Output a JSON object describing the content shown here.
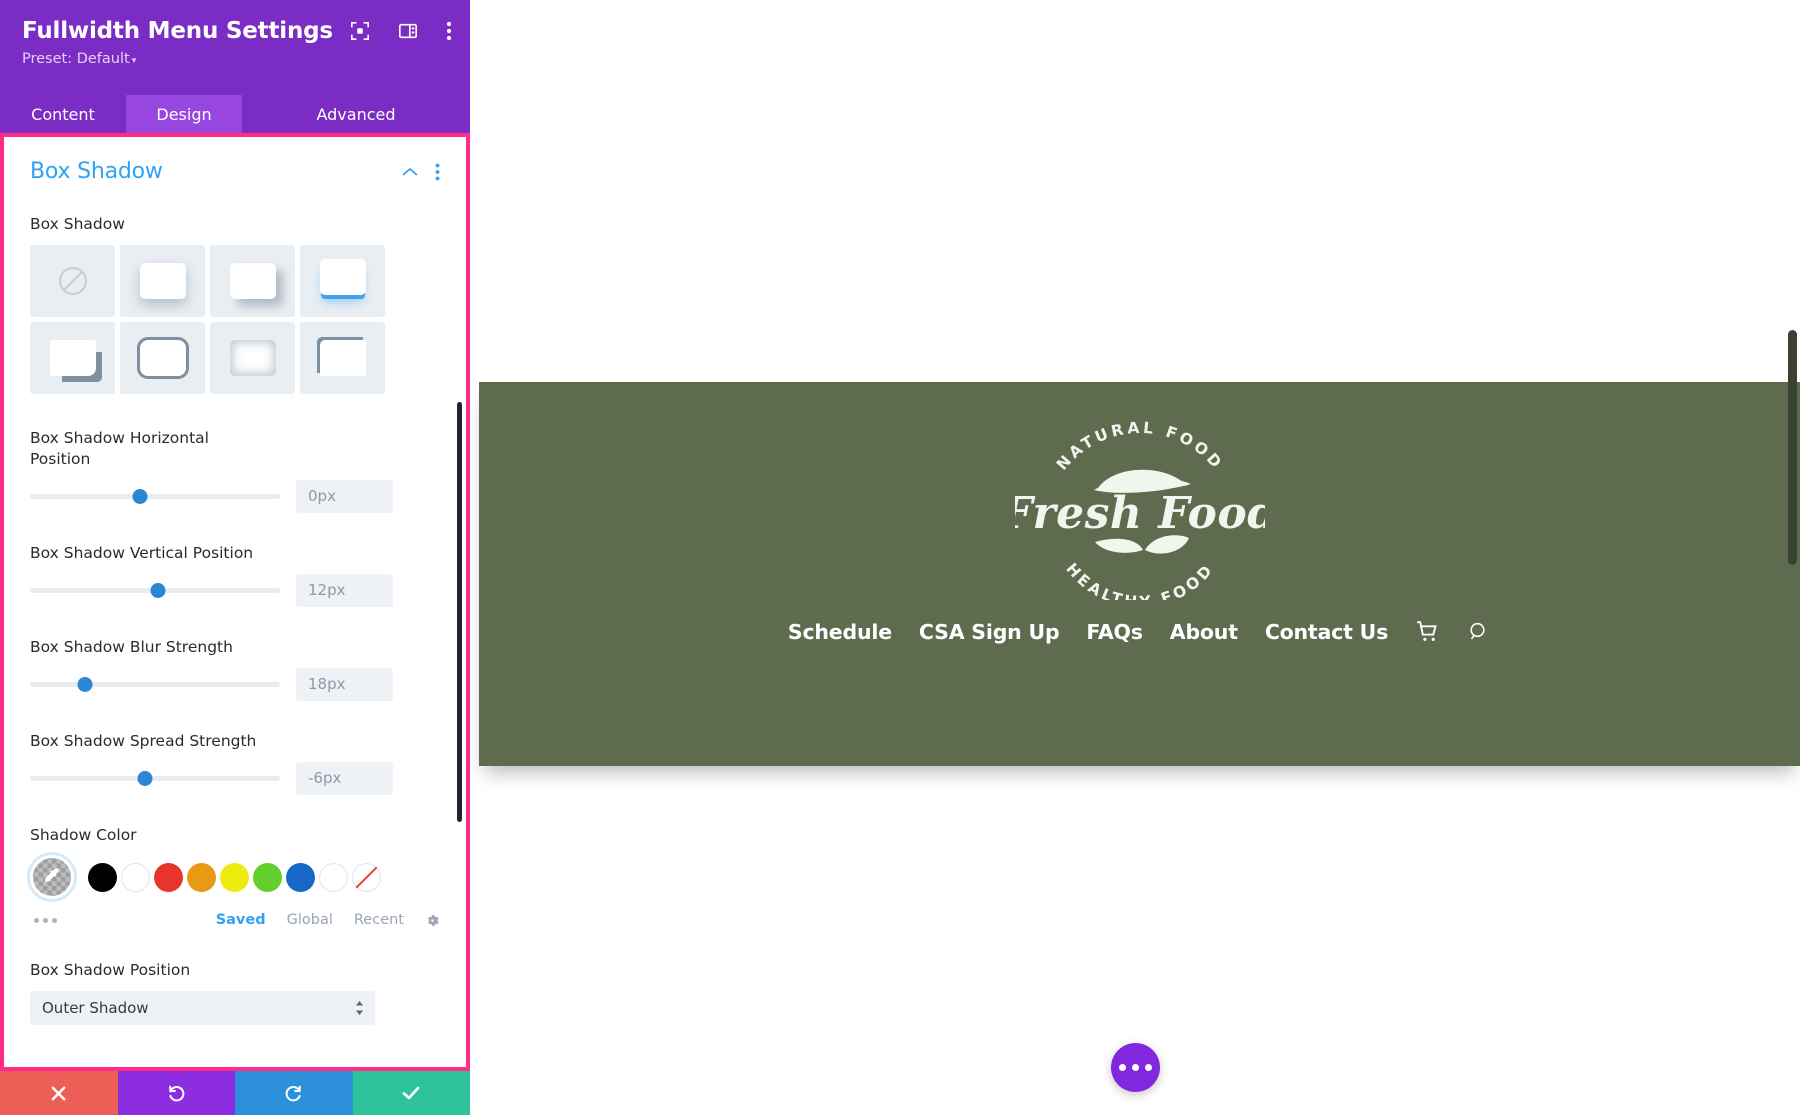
{
  "panel": {
    "title": "Fullwidth Menu Settings",
    "preset_label": "Preset: Default",
    "preset_caret": "▾",
    "header_icons": [
      {
        "name": "focus-icon"
      },
      {
        "name": "layout-panel-icon"
      },
      {
        "name": "kebab-menu-icon"
      }
    ],
    "tabs": [
      {
        "label": "Content",
        "active": false
      },
      {
        "label": "Design",
        "active": true
      },
      {
        "label": "Advanced",
        "active": false
      }
    ],
    "section": {
      "title": "Box Shadow",
      "collapse_icon": "chevron-up-icon",
      "menu_icon": "kebab-menu-icon"
    },
    "box_shadow_field_label": "Box Shadow",
    "presets": [
      {
        "name": "shadow-preset-none",
        "selected": false
      },
      {
        "name": "shadow-preset-bottom",
        "selected": false
      },
      {
        "name": "shadow-preset-diagonal",
        "selected": false
      },
      {
        "name": "shadow-preset-underline-blue",
        "selected": false
      },
      {
        "name": "shadow-preset-offset-solid",
        "selected": false
      },
      {
        "name": "shadow-preset-outline",
        "selected": false
      },
      {
        "name": "shadow-preset-inset",
        "selected": false
      },
      {
        "name": "shadow-preset-corner",
        "selected": false
      }
    ],
    "sliders": [
      {
        "label": "Box Shadow Horizontal Position",
        "value": "0px",
        "knob_percent": 44
      },
      {
        "label": "Box Shadow Vertical Position",
        "value": "12px",
        "knob_percent": 51
      },
      {
        "label": "Box Shadow Blur Strength",
        "value": "18px",
        "knob_percent": 17
      },
      {
        "label": "Box Shadow Spread Strength",
        "value": "-6px",
        "knob_percent": 40
      }
    ],
    "shadow_color": {
      "label": "Shadow Color",
      "picker_icon": "eyedropper-icon",
      "swatches": [
        {
          "name": "swatch-black",
          "hex": "#000000"
        },
        {
          "name": "swatch-white",
          "hex": "#ffffff"
        },
        {
          "name": "swatch-red",
          "hex": "#e8342c"
        },
        {
          "name": "swatch-orange",
          "hex": "#e99a13"
        },
        {
          "name": "swatch-yellow",
          "hex": "#edec0e"
        },
        {
          "name": "swatch-green",
          "hex": "#63cf2c"
        },
        {
          "name": "swatch-blue",
          "hex": "#1668c8"
        },
        {
          "name": "swatch-white-outline",
          "hex": "#ffffff"
        },
        {
          "name": "swatch-transparent",
          "hex": "transparent"
        }
      ],
      "more_icon": "ellipsis-icon",
      "palette_tabs": [
        {
          "label": "Saved",
          "active": true
        },
        {
          "label": "Global",
          "active": false
        },
        {
          "label": "Recent",
          "active": false
        }
      ],
      "settings_icon": "gear-icon"
    },
    "position_field": {
      "label": "Box Shadow Position",
      "value": "Outer Shadow",
      "arrows_icon": "sort-arrows-icon"
    },
    "actions": [
      {
        "name": "cancel-button",
        "icon": "close-icon",
        "color": "#ec5f56"
      },
      {
        "name": "undo-button",
        "icon": "undo-icon",
        "color": "#8c2ee0"
      },
      {
        "name": "redo-button",
        "icon": "redo-icon",
        "color": "#2b90d9"
      },
      {
        "name": "save-button",
        "icon": "check-icon",
        "color": "#2fc39b"
      }
    ]
  },
  "preview": {
    "menu_bg": "#5f6b4f",
    "logo": {
      "top_arc_text": "NATURAL FOOD",
      "center_text": "Fresh Food",
      "bottom_arc_text": "HEALTHY FOOD"
    },
    "nav_items": [
      {
        "label": "Schedule"
      },
      {
        "label": "CSA Sign Up"
      },
      {
        "label": "FAQs"
      },
      {
        "label": "About"
      },
      {
        "label": "Contact Us"
      }
    ],
    "nav_icons": [
      {
        "name": "cart-icon"
      },
      {
        "name": "search-icon"
      }
    ],
    "fab": {
      "name": "page-settings-fab",
      "icon": "ellipsis-icon",
      "color": "#8128df"
    }
  }
}
